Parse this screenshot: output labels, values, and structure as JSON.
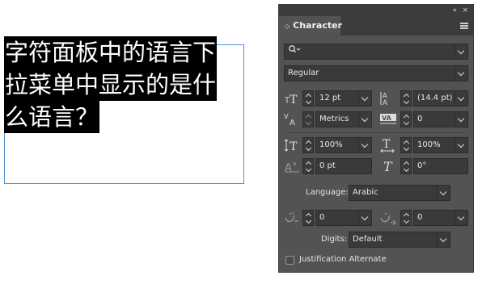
{
  "canvas": {
    "text_lines": [
      "字符面板中的语言下",
      "拉菜单中显示的是什",
      "么语言？"
    ]
  },
  "panel": {
    "collapse_glyph": "«",
    "close_glyph": "×",
    "tab_title": "Character",
    "tab_arrows": "◇",
    "font_family": "",
    "font_style": "Regular",
    "font_size": "12 pt",
    "leading": "(14.4 pt)",
    "kerning": "Metrics",
    "tracking": "0",
    "vertical_scale": "100%",
    "horizontal_scale": "100%",
    "baseline_shift": "0 pt",
    "skew": "0°",
    "language_label": "Language:",
    "language_value": "Arabic",
    "kashida_left": "0",
    "kashida_right": "0",
    "digits_label": "Digits:",
    "digits_value": "Default",
    "justification_label": "Justification Alternate"
  },
  "colors": {
    "panel_bg": "#535353",
    "field_bg": "#3a3a3a",
    "frame_border": "#4f8fcf",
    "selection_bg": "#000000"
  }
}
